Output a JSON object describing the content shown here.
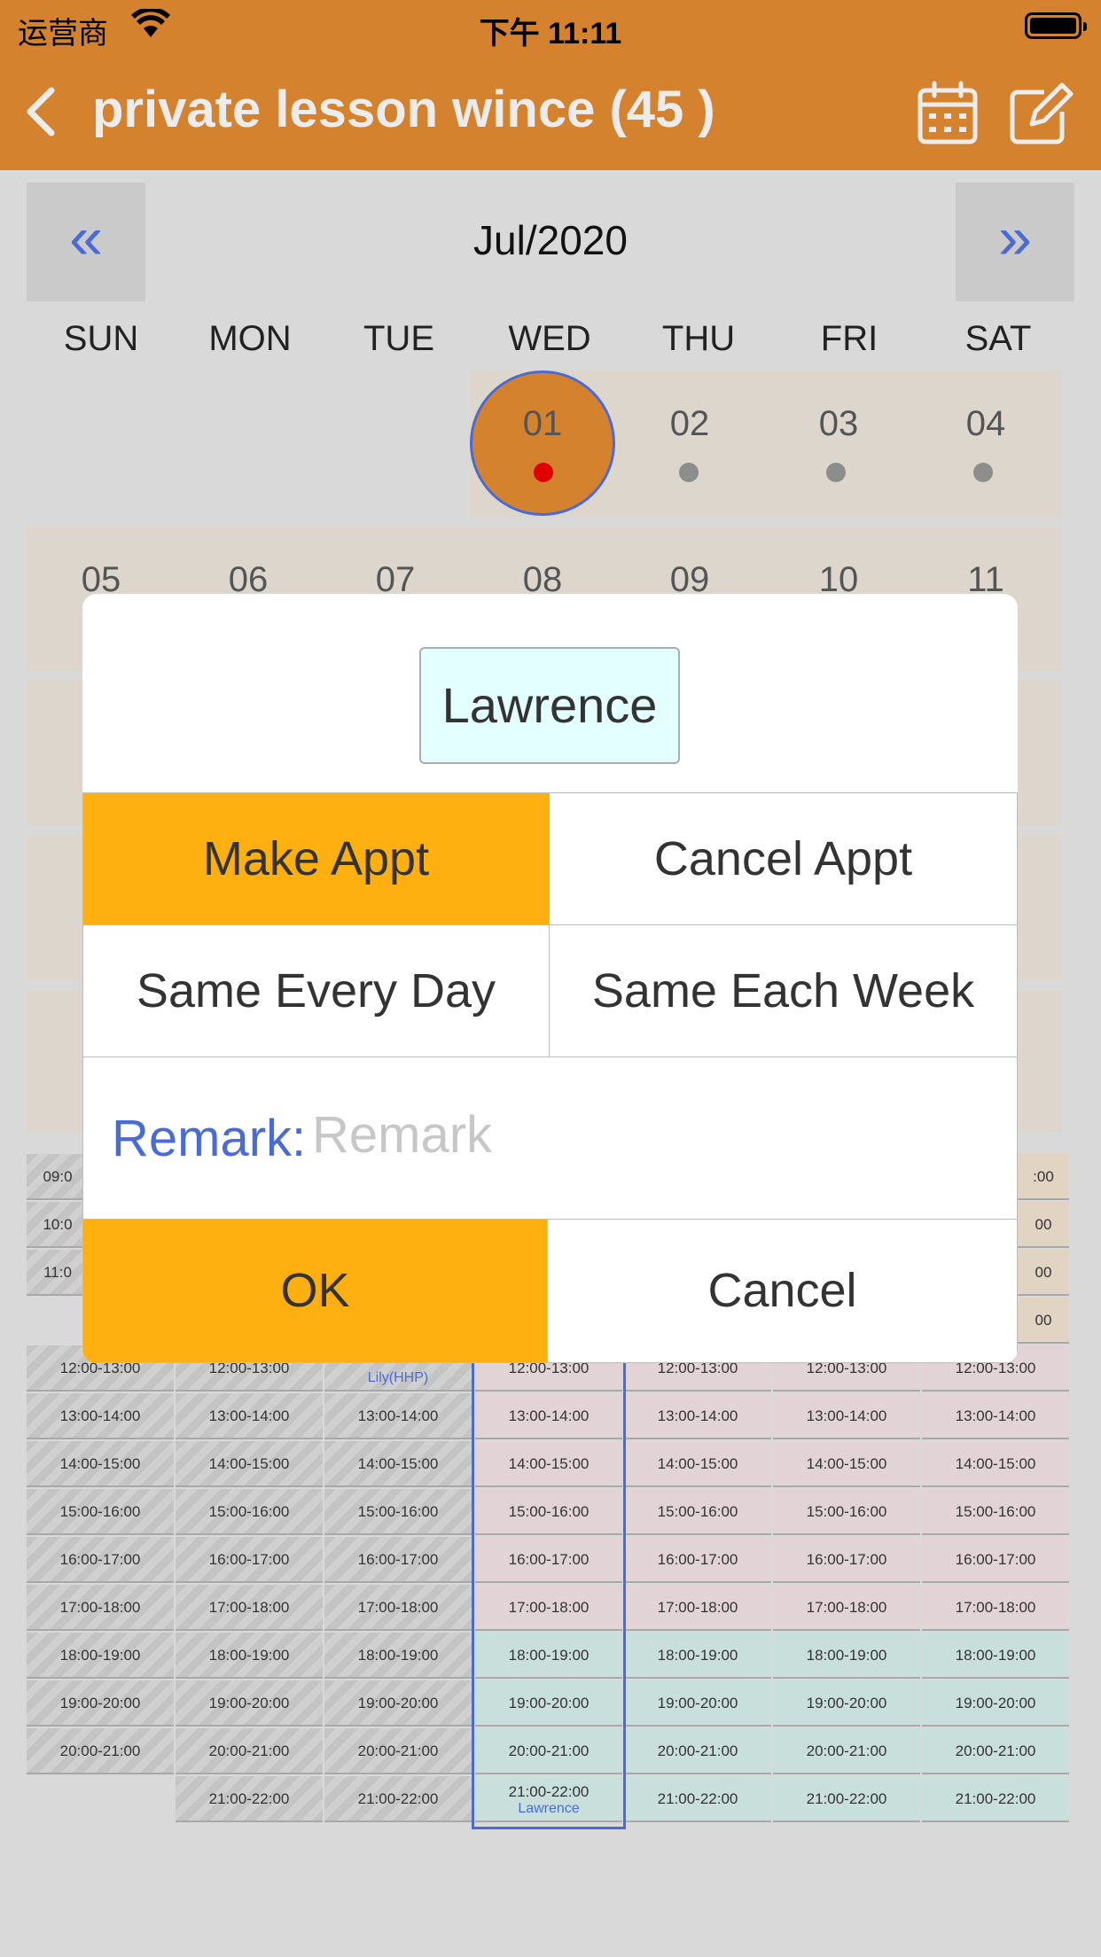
{
  "status": {
    "carrier": "运营商",
    "time": "下午 11:11"
  },
  "header": {
    "title": "private lesson wince (45 )"
  },
  "calendar": {
    "month_label": "Jul/2020",
    "prev_label": "«",
    "next_label": "»",
    "weekdays": [
      "SUN",
      "MON",
      "TUE",
      "WED",
      "THU",
      "FRI",
      "SAT"
    ],
    "week1": [
      "01",
      "02",
      "03",
      "04"
    ],
    "week2": [
      "05",
      "06",
      "07",
      "08",
      "09",
      "10",
      "11"
    ]
  },
  "schedule": {
    "partial_top": [
      "09:0",
      "10:0",
      "11:0"
    ],
    "partial_right": [
      ":00",
      "00",
      "00",
      "00"
    ],
    "slots": [
      "12:00-13:00",
      "13:00-14:00",
      "14:00-15:00",
      "15:00-16:00",
      "16:00-17:00",
      "17:00-18:00",
      "18:00-19:00",
      "19:00-20:00",
      "20:00-21:00",
      "21:00-22:00"
    ],
    "tue_partial": "12:00-13:00",
    "tue_booked_name": "Lily(HHP)",
    "wed_last_booked_name": "Lawrence"
  },
  "dialog": {
    "name": "Lawrence",
    "make_appt": "Make Appt",
    "cancel_appt": "Cancel Appt",
    "same_every_day": "Same Every Day",
    "same_each_week": "Same Each Week",
    "remark_label": "Remark:",
    "remark_placeholder": "Remark",
    "remark_value": "",
    "ok": "OK",
    "cancel": "Cancel"
  },
  "colors": {
    "header": "#d5822e",
    "accent_blue": "#4a6bd6",
    "button_orange": "#fdb010",
    "selected_dot": "#e00000"
  }
}
